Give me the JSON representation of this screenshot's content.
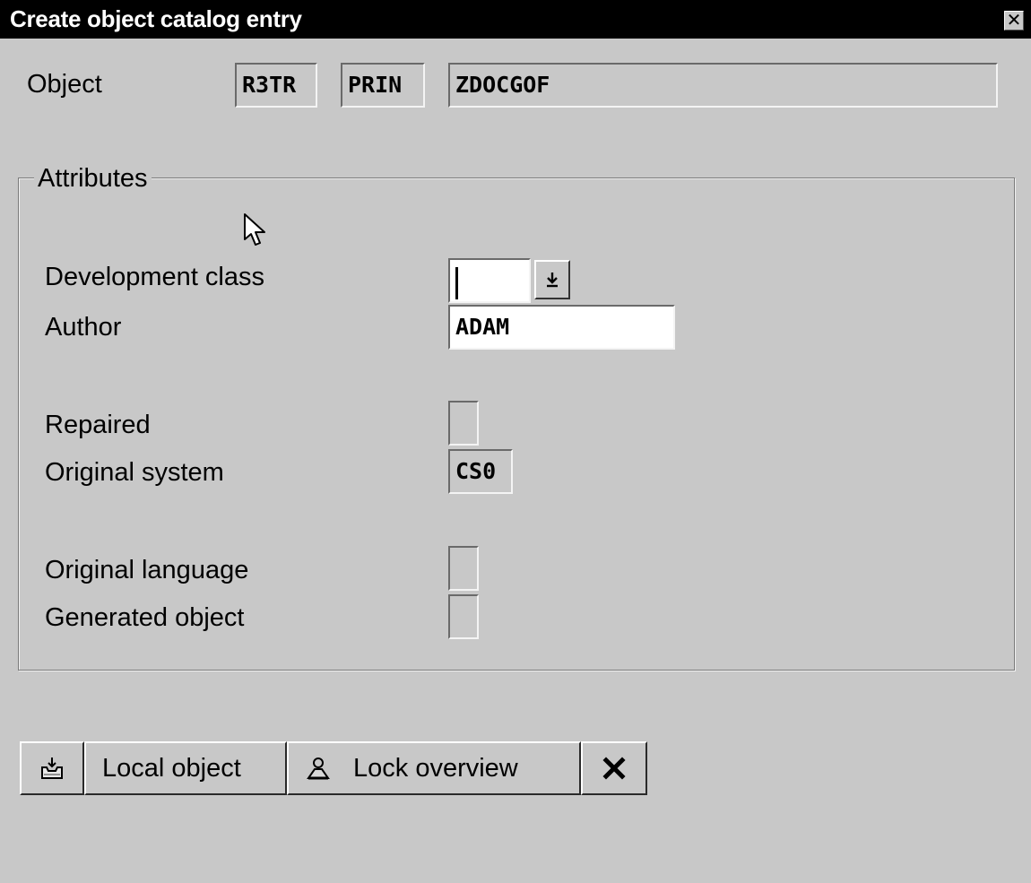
{
  "window": {
    "title": "Create object catalog entry",
    "close_icon": "close-icon"
  },
  "object": {
    "label": "Object",
    "pgmid": "R3TR",
    "type": "PRIN",
    "name": "ZDOCGOF"
  },
  "attributes": {
    "title": "Attributes",
    "development_class": {
      "label": "Development class",
      "value": "",
      "dropdown_icon": "dropdown-arrow-icon"
    },
    "author": {
      "label": "Author",
      "value": "ADAM"
    },
    "repaired": {
      "label": "Repaired",
      "value": ""
    },
    "original_system": {
      "label": "Original system",
      "value": "CS0"
    },
    "original_language": {
      "label": "Original language",
      "value": ""
    },
    "generated_object": {
      "label": "Generated object",
      "value": ""
    }
  },
  "toolbar": {
    "save_icon": "save-icon",
    "local_object_label": "Local object",
    "lock_overview_icon": "lock-overview-icon",
    "lock_overview_label": "Lock overview",
    "cancel_icon": "cancel-icon"
  }
}
